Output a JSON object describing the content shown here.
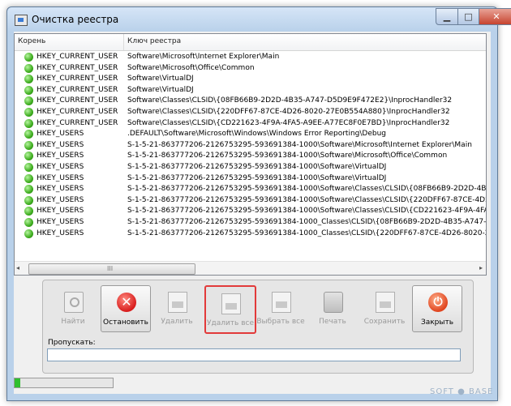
{
  "window": {
    "title": "Очистка реестра"
  },
  "list": {
    "columns": [
      "Корень",
      "Ключ реестра"
    ],
    "rows": [
      {
        "root": "HKEY_CURRENT_USER",
        "key": "Software\\Microsoft\\Internet Explorer\\Main"
      },
      {
        "root": "HKEY_CURRENT_USER",
        "key": "Software\\Microsoft\\Office\\Common"
      },
      {
        "root": "HKEY_CURRENT_USER",
        "key": "Software\\VirtualDJ"
      },
      {
        "root": "HKEY_CURRENT_USER",
        "key": "Software\\VirtualDJ"
      },
      {
        "root": "HKEY_CURRENT_USER",
        "key": "Software\\Classes\\CLSID\\{08FB66B9-2D2D-4B35-A747-D5D9E9F472E2}\\InprocHandler32"
      },
      {
        "root": "HKEY_CURRENT_USER",
        "key": "Software\\Classes\\CLSID\\{220DFF67-87CE-4D26-8020-27E0B554A880}\\InprocHandler32"
      },
      {
        "root": "HKEY_CURRENT_USER",
        "key": "Software\\Classes\\CLSID\\{CD221623-4F9A-4FA5-A9EE-A77EC8F0E7BD}\\InprocHandler32"
      },
      {
        "root": "HKEY_USERS",
        "key": ".DEFAULT\\Software\\Microsoft\\Windows\\Windows Error Reporting\\Debug"
      },
      {
        "root": "HKEY_USERS",
        "key": "S-1-5-21-863777206-2126753295-593691384-1000\\Software\\Microsoft\\Internet Explorer\\Main"
      },
      {
        "root": "HKEY_USERS",
        "key": "S-1-5-21-863777206-2126753295-593691384-1000\\Software\\Microsoft\\Office\\Common"
      },
      {
        "root": "HKEY_USERS",
        "key": "S-1-5-21-863777206-2126753295-593691384-1000\\Software\\VirtualDJ"
      },
      {
        "root": "HKEY_USERS",
        "key": "S-1-5-21-863777206-2126753295-593691384-1000\\Software\\VirtualDJ"
      },
      {
        "root": "HKEY_USERS",
        "key": "S-1-5-21-863777206-2126753295-593691384-1000\\Software\\Classes\\CLSID\\{08FB66B9-2D2D-4B35-A747-D5D"
      },
      {
        "root": "HKEY_USERS",
        "key": "S-1-5-21-863777206-2126753295-593691384-1000\\Software\\Classes\\CLSID\\{220DFF67-87CE-4D26-8020-27E0"
      },
      {
        "root": "HKEY_USERS",
        "key": "S-1-5-21-863777206-2126753295-593691384-1000\\Software\\Classes\\CLSID\\{CD221623-4F9A-4FA5-A9EE-A77E"
      },
      {
        "root": "HKEY_USERS",
        "key": "S-1-5-21-863777206-2126753295-593691384-1000_Classes\\CLSID\\{08FB66B9-2D2D-4B35-A747-D5D9E9F472"
      },
      {
        "root": "HKEY_USERS",
        "key": "S-1-5-21-863777206-2126753295-593691384-1000_Classes\\CLSID\\{220DFF67-87CE-4D26-8020-27E0B554A88"
      }
    ]
  },
  "scrollbar": {
    "left_arrow": "◂",
    "right_arrow": "▸",
    "grip": "III"
  },
  "toolbar": {
    "find": "Найти",
    "stop": "Остановить",
    "delete": "Удалить",
    "delete_all": "Удалить все",
    "select_all": "Выбрать все",
    "print": "Печать",
    "save": "Сохранить",
    "close": "Закрыть",
    "stop_icon": "✕",
    "close_icon": "⏻"
  },
  "skip": {
    "label": "Пропускать:",
    "value": ""
  },
  "progress": {
    "fraction": 0.06
  },
  "watermark": "SOFT ● BASE"
}
